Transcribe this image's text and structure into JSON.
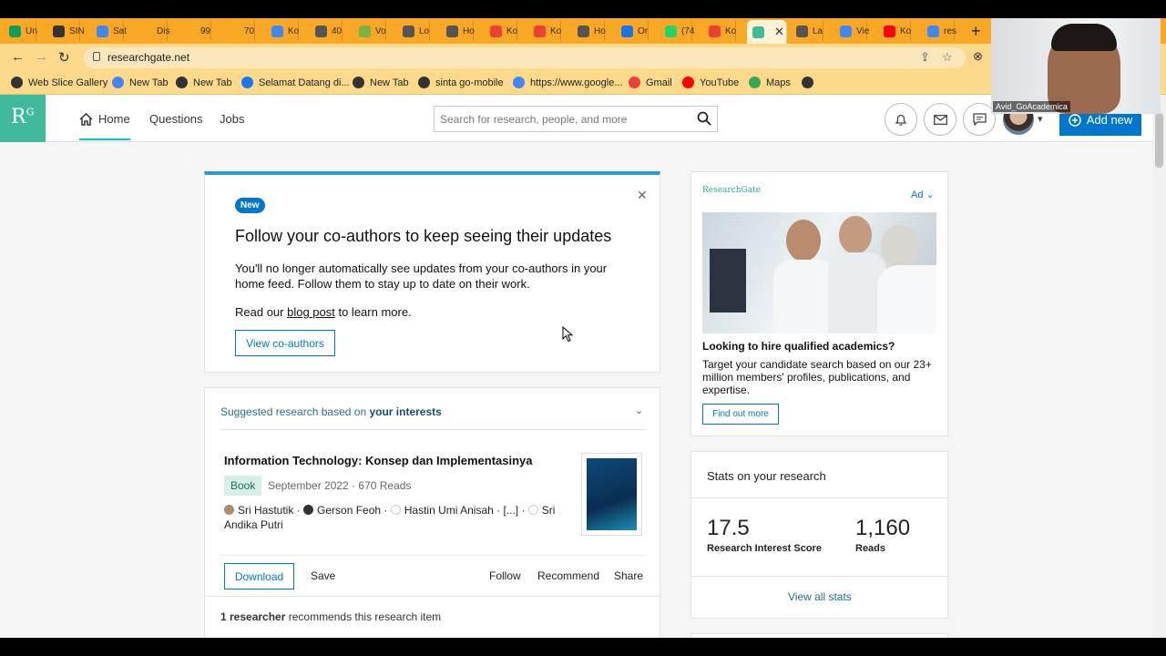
{
  "browser": {
    "tabs": [
      {
        "label": "Un",
        "color": "#0f9d58"
      },
      {
        "label": "SIN",
        "color": "#333333"
      },
      {
        "label": "Sat",
        "color": "#4285f4"
      },
      {
        "label": "Dis",
        "color": "#f9a825"
      },
      {
        "label": "99",
        "color": "#f9a825"
      },
      {
        "label": "70",
        "color": "#f9a825"
      },
      {
        "label": "Ko",
        "color": "#4285f4"
      },
      {
        "label": "40",
        "color": "#555555"
      },
      {
        "label": "Vo",
        "color": "#7cb342"
      },
      {
        "label": "Lo",
        "color": "#555555"
      },
      {
        "label": "Ho",
        "color": "#555555"
      },
      {
        "label": "Ko",
        "color": "#ea4335"
      },
      {
        "label": "Ko",
        "color": "#ea4335"
      },
      {
        "label": "Ho",
        "color": "#555555"
      },
      {
        "label": "Or",
        "color": "#1a73e8"
      },
      {
        "label": "(74",
        "color": "#25d366"
      },
      {
        "label": "Ko",
        "color": "#ea4335"
      },
      {
        "label": "",
        "color": "#40ba9b"
      },
      {
        "label": "La",
        "color": "#555555"
      },
      {
        "label": "Vie",
        "color": "#4285f4"
      },
      {
        "label": "Ko",
        "color": "#ff0000"
      },
      {
        "label": "res",
        "color": "#4285f4"
      }
    ],
    "active_tab_close": "✕",
    "new_tab": "+",
    "url": "researchgate.net",
    "bookmarks": [
      {
        "label": "Web Slice Gallery",
        "color": "#333333"
      },
      {
        "label": "New Tab",
        "color": "#4285f4"
      },
      {
        "label": "New Tab",
        "color": "#333333"
      },
      {
        "label": "Selamat Datang di...",
        "color": "#1877f2"
      },
      {
        "label": "New Tab",
        "color": "#333333"
      },
      {
        "label": "sinta go-mobile",
        "color": "#333333"
      },
      {
        "label": "https://www.google...",
        "color": "#4285f4"
      },
      {
        "label": "Gmail",
        "color": "#ea4335"
      },
      {
        "label": "YouTube",
        "color": "#ff0000"
      },
      {
        "label": "Maps",
        "color": "#34a853"
      },
      {
        "label": "",
        "color": "#333333"
      }
    ]
  },
  "header": {
    "logo_main": "R",
    "logo_sup": "G",
    "nav": {
      "home": "Home",
      "questions": "Questions",
      "jobs": "Jobs"
    },
    "search_placeholder": "Search for research, people, and more",
    "add_new": "Add new"
  },
  "promo": {
    "badge": "New",
    "title": "Follow your co-authors to keep seeing their updates",
    "body": "You'll no longer automatically see updates from your co-authors in your home feed. Follow them to stay up to date on their work.",
    "read_prefix": "Read our ",
    "read_link": "blog post",
    "read_suffix": " to learn more.",
    "button": "View co-authors"
  },
  "research": {
    "header_prefix": "Suggested research based on ",
    "header_bold": "your interests",
    "title": "Information Technology: Konsep dan Implementasinya",
    "type": "Book",
    "meta": "September 2022 · 670 Reads",
    "authors": {
      "a1": "Sri Hastutik",
      "sep1": " · ",
      "a2": "Gerson Feoh",
      "sep2": " · ",
      "a3": "Hastin Umi Anisah",
      "sep3": " · [...] · ",
      "a4": "Sri Andika Putri"
    },
    "actions": {
      "download": "Download",
      "save": "Save",
      "follow": "Follow",
      "recommend": "Recommend",
      "share": "Share"
    },
    "rec_count": "1 researcher",
    "rec_text": " recommends this research item"
  },
  "ad": {
    "brand": "ResearchGate",
    "label": "Ad",
    "headline": "Looking to hire qualified academics?",
    "text": "Target your candidate search based on our 23+ million members' profiles, publications, and expertise.",
    "button": "Find out more"
  },
  "stats": {
    "title": "Stats on your research",
    "score": "17.5",
    "score_label": "Research Interest Score",
    "reads": "1,160",
    "reads_label": "Reads",
    "view_all": "View all stats"
  },
  "webcam": {
    "name": "Avid_GoAcademica"
  }
}
